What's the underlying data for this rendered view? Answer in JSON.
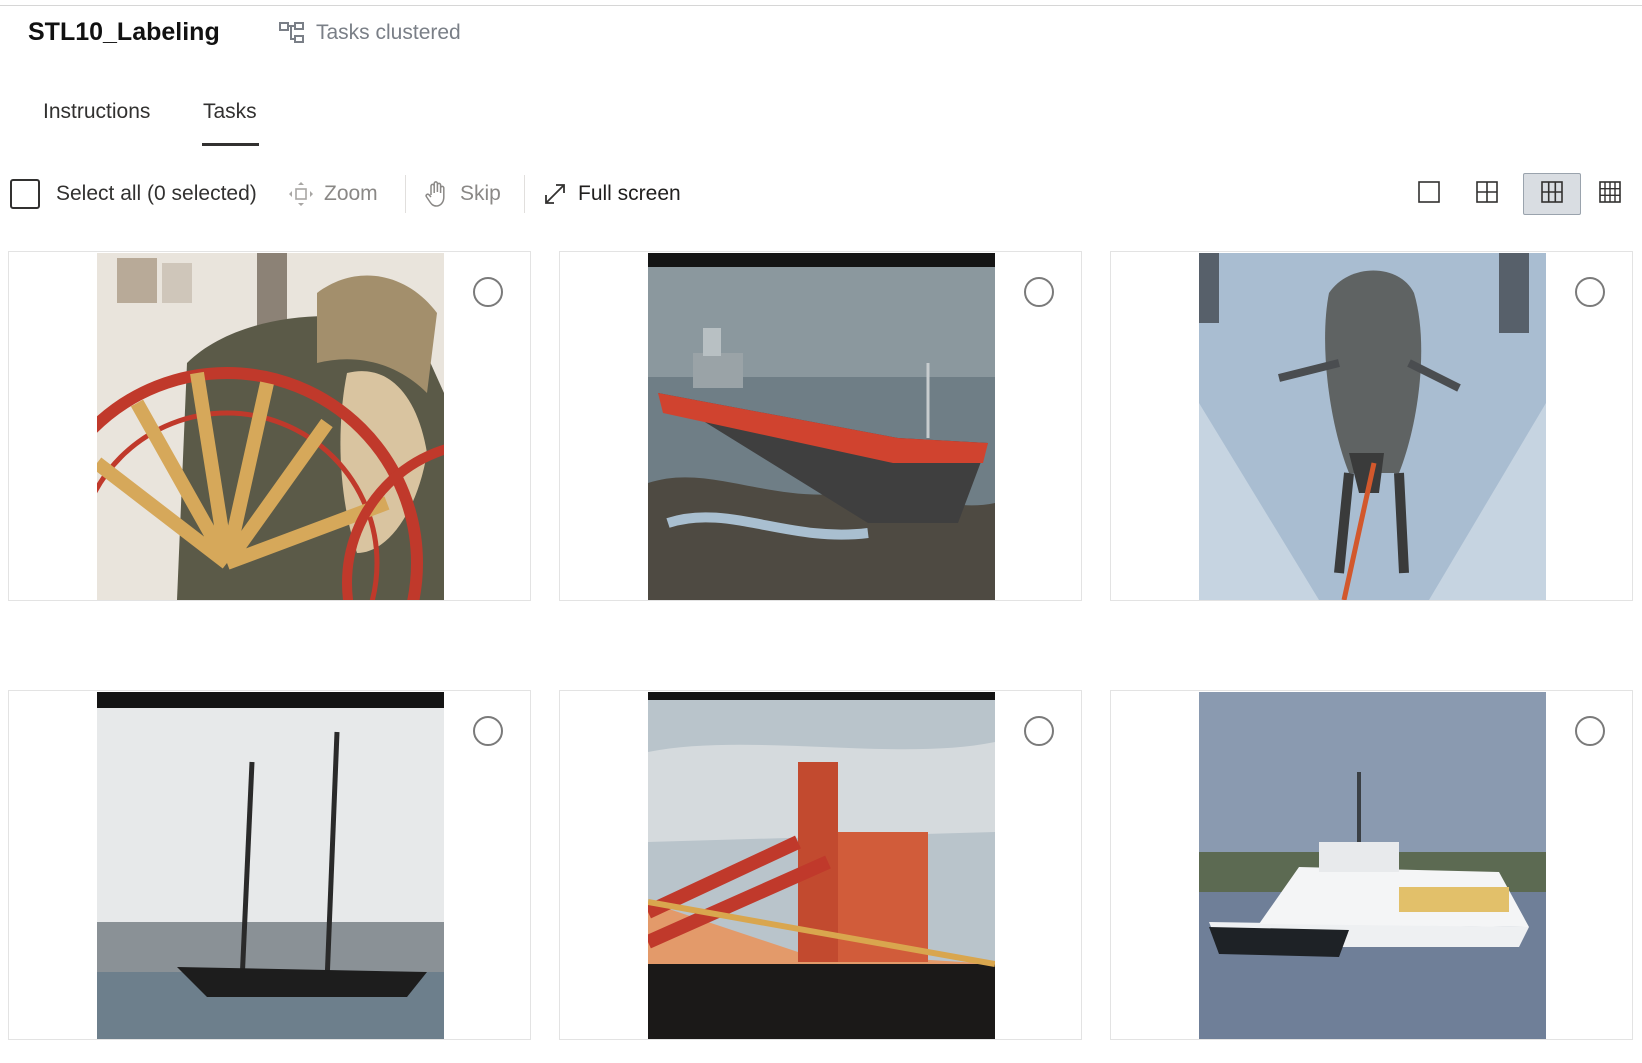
{
  "header": {
    "title": "STL10_Labeling",
    "clustered_label": "Tasks clustered",
    "clustered_icon": "cluster-icon"
  },
  "tabs": [
    {
      "label": "Instructions",
      "active": false
    },
    {
      "label": "Tasks",
      "active": true
    }
  ],
  "toolbar": {
    "select_all_label": "Select all (0 selected)",
    "zoom_label": "Zoom",
    "skip_label": "Skip",
    "fullscreen_label": "Full screen",
    "view_options": [
      "single-view-icon",
      "grid-2x2-icon",
      "grid-3x3-icon",
      "grid-4x4-icon"
    ],
    "active_view": "grid-3x3-icon"
  },
  "tasks": [
    {
      "image": "horse-cart-image",
      "selected": false
    },
    {
      "image": "red-cargo-ship-image",
      "selected": false
    },
    {
      "image": "reindeer-image",
      "selected": false
    },
    {
      "image": "sailing-schooner-image",
      "selected": false
    },
    {
      "image": "ship-deck-image",
      "selected": false
    },
    {
      "image": "white-ferry-image",
      "selected": false
    }
  ],
  "colors": {
    "text": "#201f1e",
    "muted": "#8a8886",
    "active_view_bg": "#d9dde2",
    "card_border": "#e3e3e3"
  }
}
